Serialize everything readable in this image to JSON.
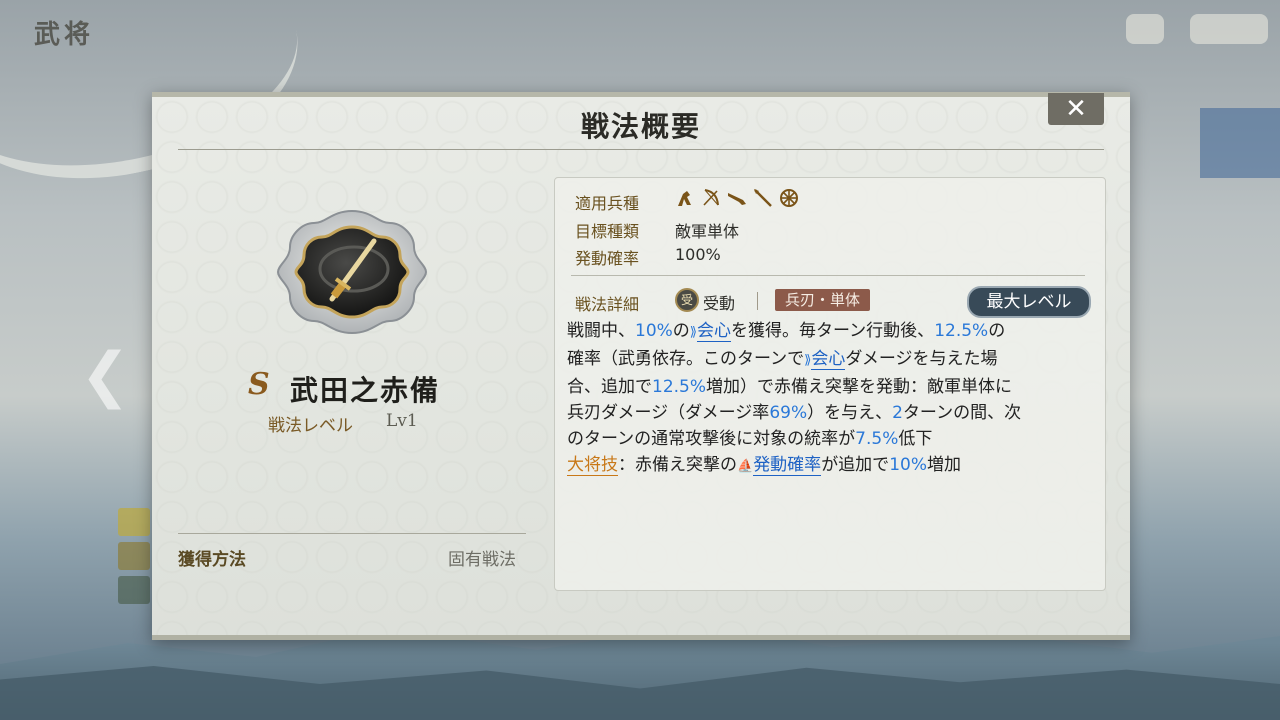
{
  "background": {
    "corner_title": "武将"
  },
  "panel": {
    "title": "戦法概要",
    "close_label": "✕"
  },
  "skill": {
    "grade": "S",
    "name": "武田之赤備",
    "level_label": "戦法レベル",
    "level_value": "Lv1",
    "acquire_label": "獲得方法",
    "acquire_value": "固有戦法"
  },
  "info": {
    "unit_label": "適用兵種",
    "unit_icons": [
      "cavalry-icon",
      "archer-icon",
      "gun-icon",
      "spear-icon",
      "wheel-icon"
    ],
    "target_label": "目標種類",
    "target_value": "敵軍単体",
    "rate_label": "発動確率",
    "rate_value": "100%",
    "detail_label": "戦法詳細",
    "passive_icon_glyph": "受",
    "passive_label": "受動",
    "tag_label": "兵刃・単体",
    "max_level_label": "最大レベル"
  },
  "description": {
    "l1_a": "戦闘中、",
    "l1_b": "10%",
    "l1_c": "の",
    "l1_d": "会心",
    "l1_e": "を獲得。毎ターン行動後、",
    "l1_f": "12.5%",
    "l1_g": "の",
    "l2_a": "確率（武勇依存。このターンで",
    "l2_b": "会心",
    "l2_c": "ダメージを与えた場",
    "l3_a": "合、追加で",
    "l3_b": "12.5%",
    "l3_c": "増加）で赤備え突撃を発動：敵軍単体に",
    "l4_a": "兵刃ダメージ（ダメージ率",
    "l4_b": "69%",
    "l4_c": "）を与え、",
    "l4_d": "2",
    "l4_e": "ターンの間、次",
    "l5_a": "のターンの通常攻撃後に対象の統率が",
    "l5_b": "7.5%",
    "l5_c": "低下",
    "l6_a": "大将技",
    "l6_b": "：赤備え突撃の",
    "l6_c": "発動確率",
    "l6_d": "が追加で",
    "l6_e": "10%",
    "l6_f": "増加"
  }
}
